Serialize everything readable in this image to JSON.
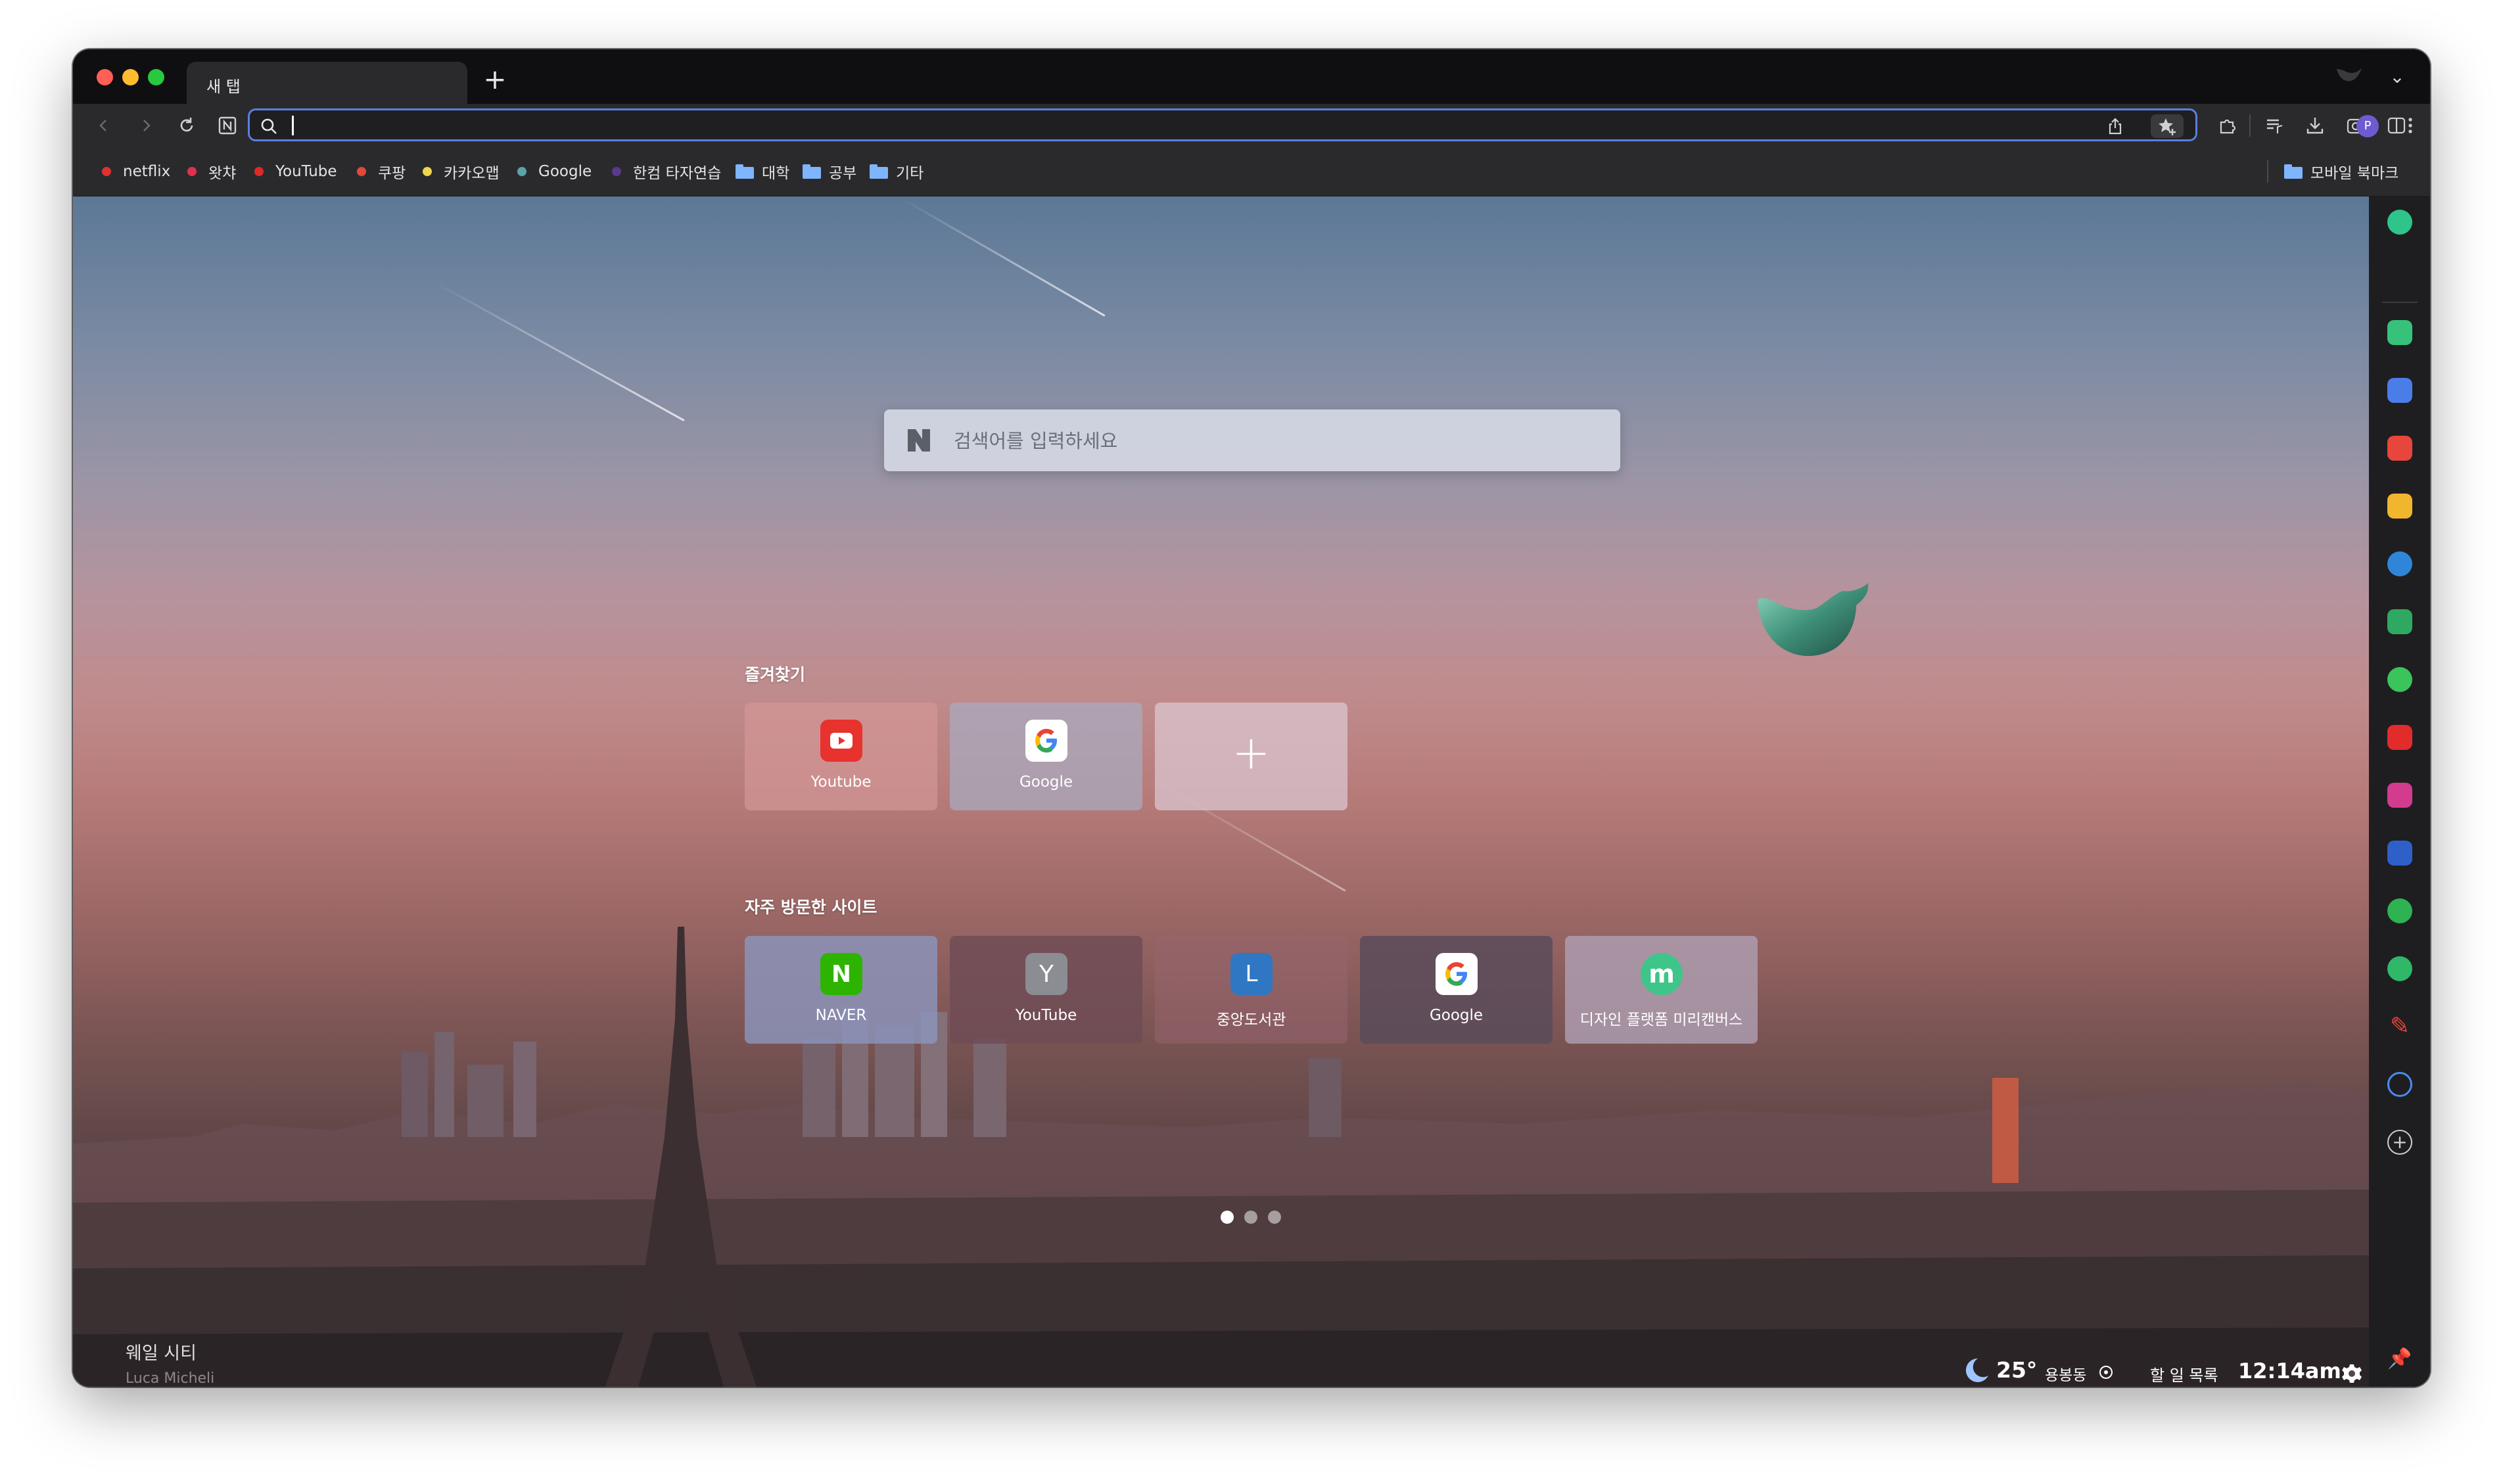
{
  "tab": {
    "title": "새 탭",
    "new_tab": "+"
  },
  "toolbar": {
    "profile_initial": "P",
    "address_value": ""
  },
  "bookmarks": [
    {
      "label": "netflix",
      "kind": "dot",
      "color": "#e03030"
    },
    {
      "label": "왓챠",
      "kind": "dot",
      "color": "#e0304e"
    },
    {
      "label": "YouTube",
      "kind": "dot",
      "color": "#e02828"
    },
    {
      "label": "쿠팡",
      "kind": "dot",
      "color": "#e0493b"
    },
    {
      "label": "카카오맵",
      "kind": "dot",
      "color": "#f0d64b"
    },
    {
      "label": "Google",
      "kind": "dot",
      "color": "#5aa3a8"
    },
    {
      "label": "한컴 타자연습",
      "kind": "dot",
      "color": "#5a3a8a"
    },
    {
      "label": "대학",
      "kind": "folder"
    },
    {
      "label": "공부",
      "kind": "folder"
    },
    {
      "label": "기타",
      "kind": "folder"
    }
  ],
  "mobile_bookmarks": "모바일 북마크",
  "search": {
    "placeholder": "검색어를 입력하세요"
  },
  "favorites": {
    "title": "즐겨찾기",
    "items": [
      {
        "label": "Youtube",
        "icon": "youtube-icon"
      },
      {
        "label": "Google",
        "icon": "google-icon"
      },
      {
        "label": "+",
        "icon": "add-icon"
      }
    ]
  },
  "frequent": {
    "title": "자주 방문한 사이트",
    "items": [
      {
        "label": "NAVER",
        "letter": "N"
      },
      {
        "label": "YouTube",
        "letter": "Y"
      },
      {
        "label": "중앙도서관",
        "letter": "L"
      },
      {
        "label": "Google",
        "letter": "G"
      },
      {
        "label": "디자인 플랫폼 미리캔버스",
        "letter": "m"
      }
    ]
  },
  "background": {
    "title": "웨일 시티",
    "author": "Luca Micheli"
  },
  "status": {
    "temperature": "25°",
    "location": "용봉동",
    "todo": "할 일 목록",
    "time": "12:14am"
  },
  "colors": {
    "accent": "#5b7fe0",
    "sidebar_bg": "#1e1e21"
  }
}
